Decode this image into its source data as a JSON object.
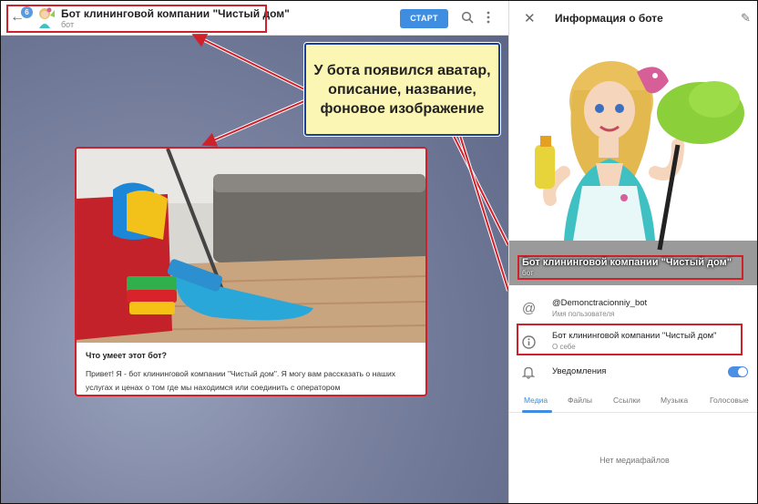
{
  "chat": {
    "badge": "6",
    "title": "Бот клининговой компании \"Чистый дом\"",
    "subtitle": "бот",
    "start_label": "СТАРТ",
    "card": {
      "question": "Что умеет этот бот?",
      "text": "Привет! Я - бот клининговой компании \"Чистый дом\". Я могу вам рассказать о наших услугах и ценах о том где мы находимся или соединить с оператором"
    }
  },
  "callout": {
    "text": "У бота появился аватар, описание, название, фоновое изображение"
  },
  "info": {
    "title": "Информация о боте",
    "name": "Бот клининговой компании \"Чистый дом\"",
    "name_sub": "бот",
    "username": "@Demonctracionniy_bot",
    "username_label": "Имя пользователя",
    "about": "Бот клининговой компании \"Чистый дом\"",
    "about_label": "О себе",
    "notifications": "Уведомления",
    "notifications_on": true,
    "tabs": [
      "Медиа",
      "Файлы",
      "Ссылки",
      "Музыка",
      "Голосовые"
    ],
    "active_tab": "Медиа",
    "empty": "Нет медиафайлов"
  },
  "colors": {
    "accent": "#3e8de0",
    "highlight": "#d0202a",
    "callout_bg": "#fbf6b4",
    "callout_border": "#1a3e9a"
  },
  "icons": [
    "back-arrow-icon",
    "search-icon",
    "more-vertical-icon",
    "close-icon",
    "edit-pencil-icon",
    "at-sign-icon",
    "info-icon",
    "bell-icon"
  ]
}
